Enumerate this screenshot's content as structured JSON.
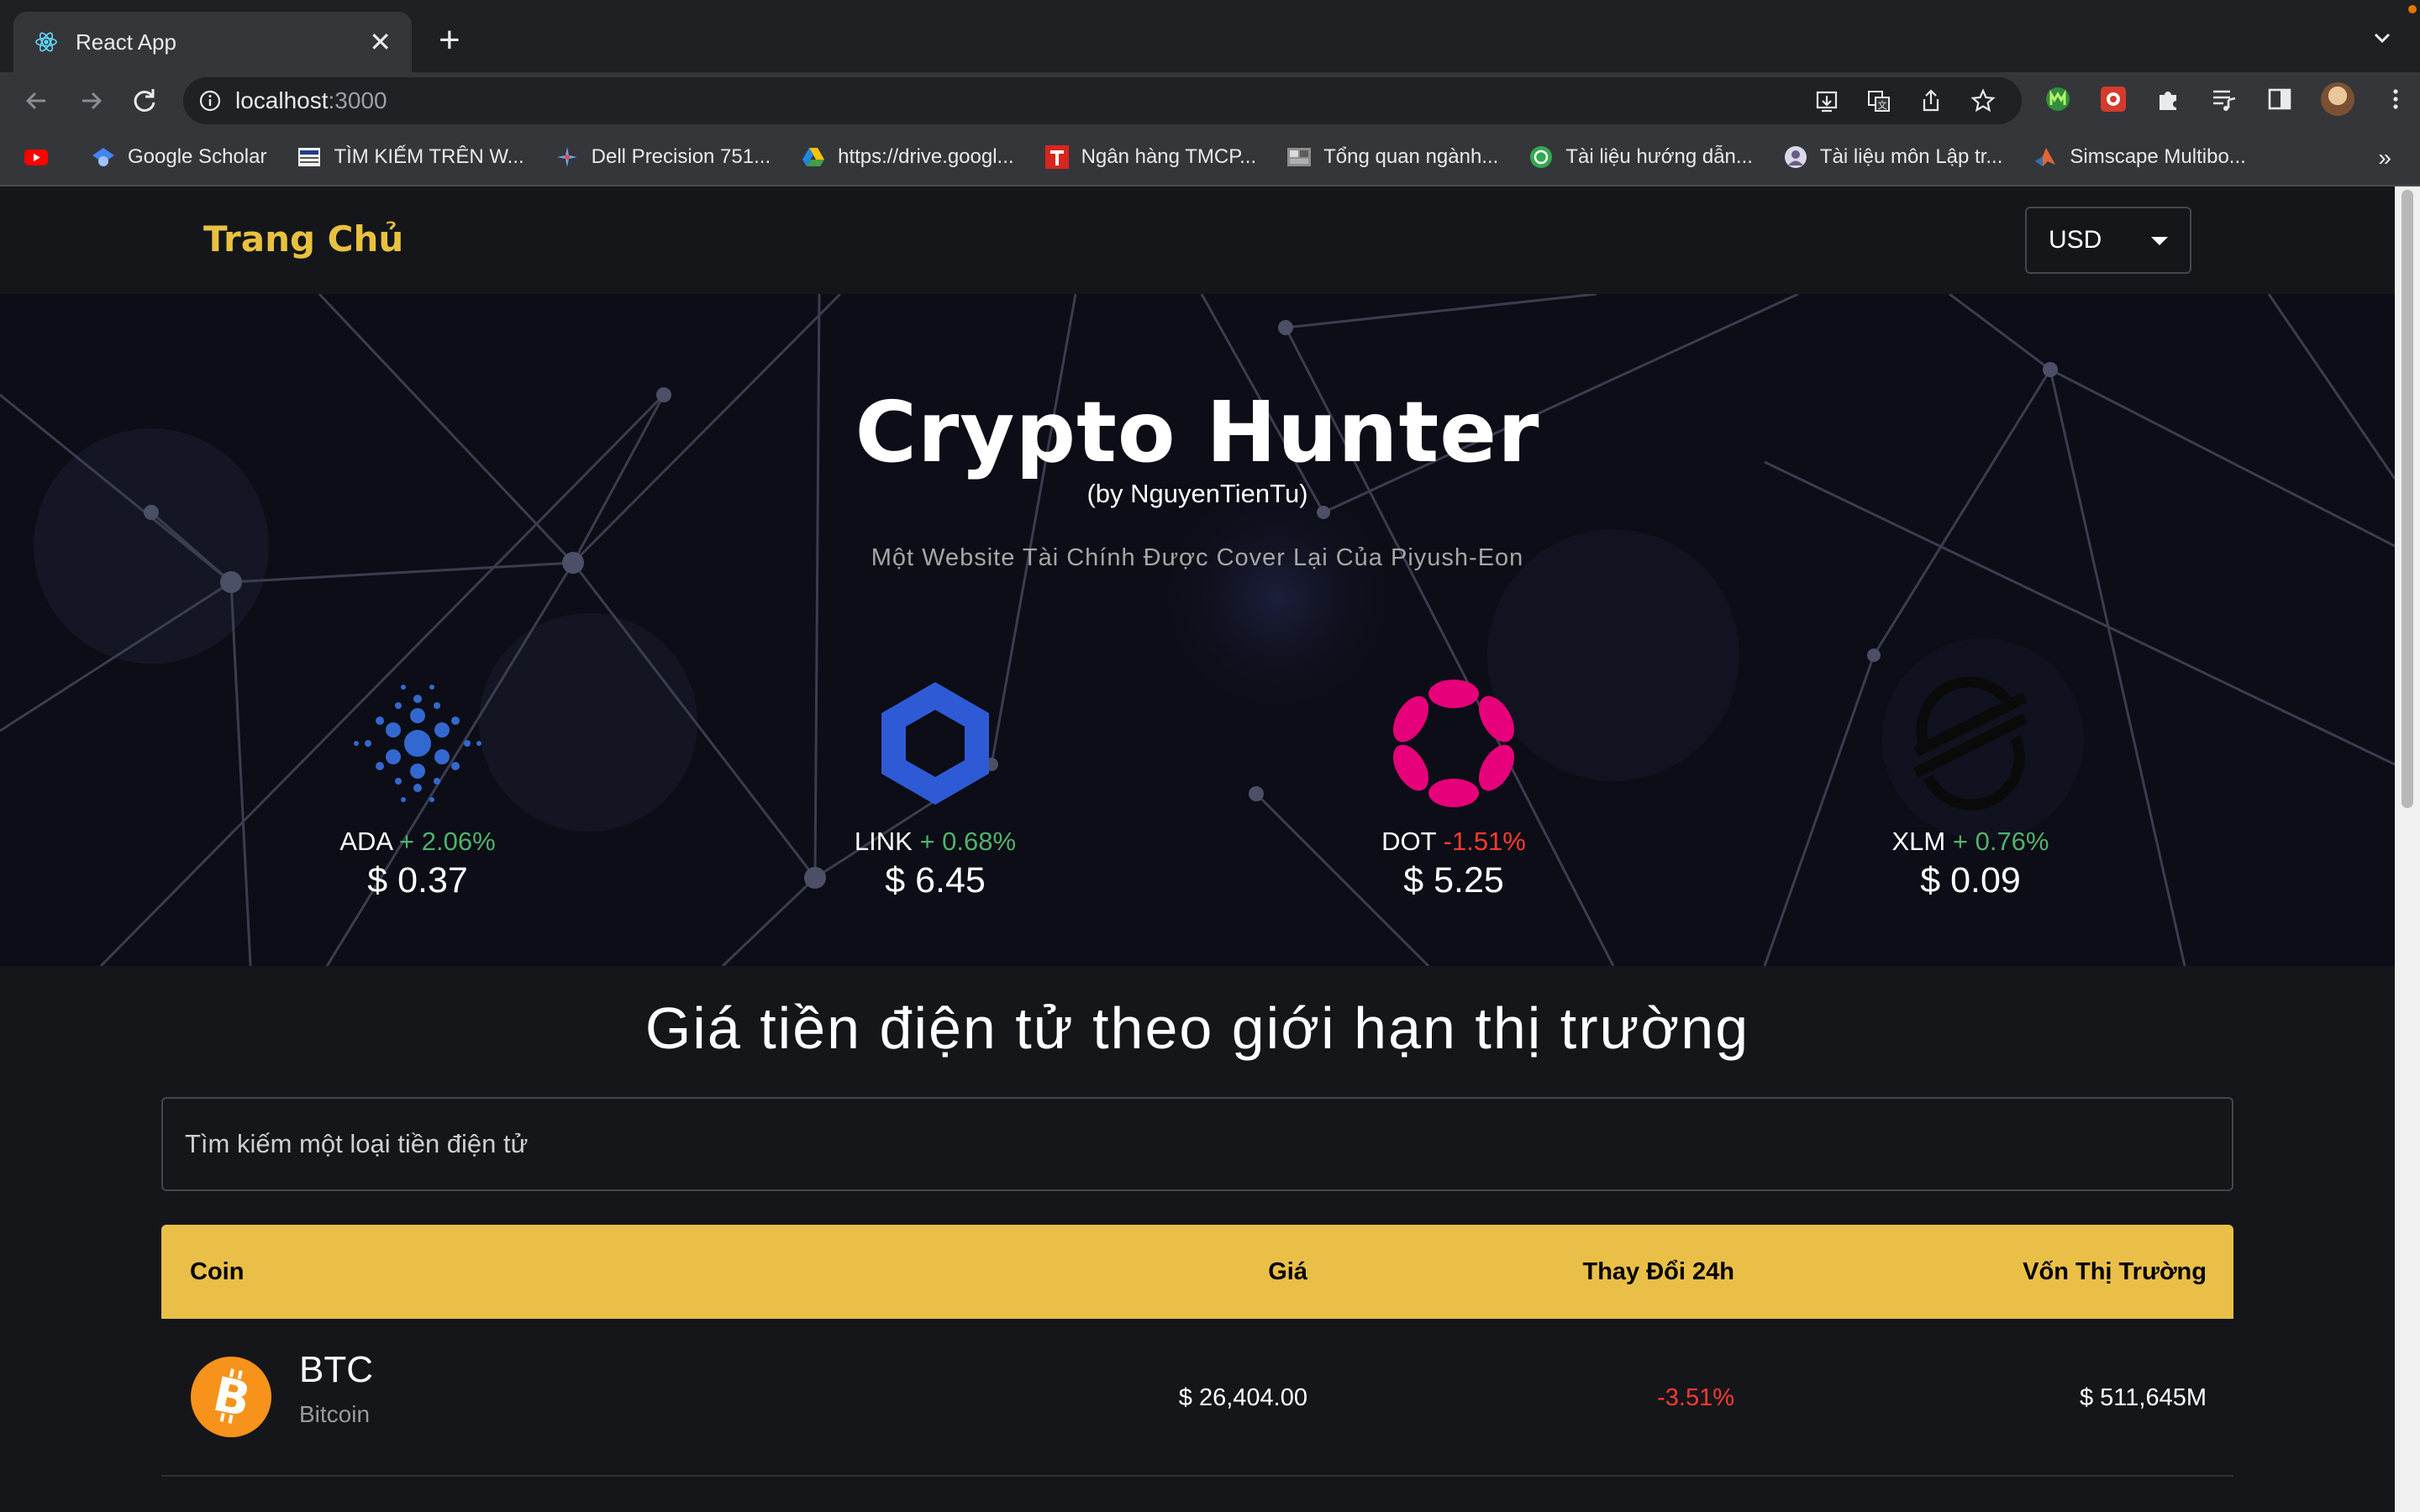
{
  "browser": {
    "tab_title": "React App",
    "close_glyph": "✕",
    "new_tab_glyph": "+",
    "url_host": "localhost",
    "url_port": ":3000",
    "bookmarks": [
      {
        "label": "",
        "icon": "youtube-icon"
      },
      {
        "label": "Google Scholar",
        "icon": "scholar-icon"
      },
      {
        "label": "TÌM KIẾM TRÊN W...",
        "icon": "library-icon"
      },
      {
        "label": "Dell Precision 751...",
        "icon": "dell-icon"
      },
      {
        "label": "https://drive.googl...",
        "icon": "drive-icon"
      },
      {
        "label": "Ngân hàng TMCP...",
        "icon": "bank-icon"
      },
      {
        "label": "Tổng quan ngành...",
        "icon": "image-icon"
      },
      {
        "label": "Tài liệu hướng dẫn...",
        "icon": "docs-icon"
      },
      {
        "label": "Tài liệu môn Lập tr...",
        "icon": "user-icon"
      },
      {
        "label": "Simscape Multibo...",
        "icon": "matlab-icon"
      }
    ],
    "more_glyph": "»"
  },
  "app": {
    "brand": "Trang Chủ",
    "currency": "USD"
  },
  "hero": {
    "title": "Crypto Hunter",
    "by": "(by NguyenTienTu)",
    "subtitle": "Một Website Tài Chính Được Cover Lại Của Piyush-Eon",
    "coins": [
      {
        "symbol": "ADA",
        "change": "+ 2.06%",
        "direction": "up",
        "price": "$ 0.37",
        "icon": "cardano-icon"
      },
      {
        "symbol": "LINK",
        "change": "+ 0.68%",
        "direction": "up",
        "price": "$ 6.45",
        "icon": "chainlink-icon"
      },
      {
        "symbol": "DOT",
        "change": "-1.51%",
        "direction": "down",
        "price": "$ 5.25",
        "icon": "polkadot-icon"
      },
      {
        "symbol": "XLM",
        "change": "+ 0.76%",
        "direction": "up",
        "price": "$ 0.09",
        "icon": "stellar-icon"
      }
    ]
  },
  "market": {
    "title": "Giá tiền điện tử theo giới hạn thị trường",
    "search_placeholder": "Tìm kiếm một loại tiền điện tử",
    "columns": [
      "Coin",
      "Giá",
      "Thay Đổi 24h",
      "Vốn Thị Trường"
    ],
    "rows": [
      {
        "symbol": "BTC",
        "name": "Bitcoin",
        "price": "$ 26,404.00",
        "change": "-3.51%",
        "market_cap": "$ 511,645M",
        "icon": "bitcoin-icon"
      }
    ]
  },
  "colors": {
    "accent": "#e9c13f",
    "header_bg": "#e9bf47",
    "up": "#4fb36a",
    "down": "#ff3b30"
  }
}
